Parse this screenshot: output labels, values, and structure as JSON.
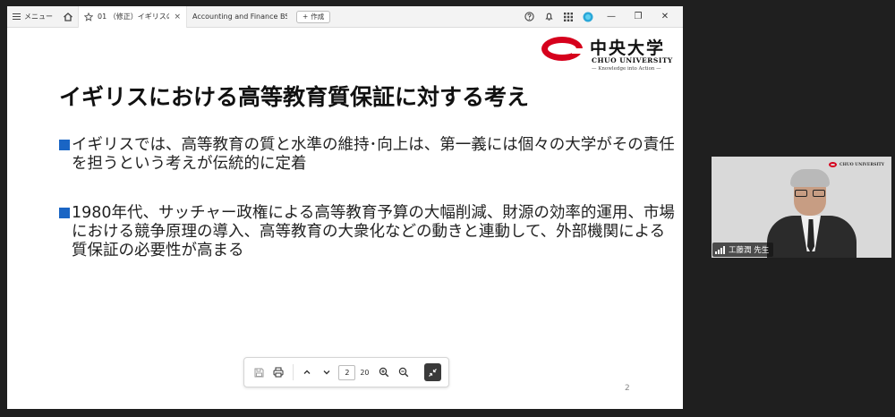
{
  "tab_bar": {
    "menu_label": "メニュー",
    "active_tab_title": "01 （修正）イギリスの...",
    "inactive_tab_title": "Accounting and Finance BSc...",
    "new_button_label": "作成",
    "close_glyph": "×",
    "new_glyph": "+"
  },
  "window_controls": {
    "minimize": "—",
    "restore": "❐",
    "close": "✕"
  },
  "slide": {
    "logo": {
      "name_jp": "中央大学",
      "name_en": "CHUO UNIVERSITY",
      "tagline": "— Knowledge into Action —"
    },
    "title": "イギリスにおける高等教育質保証に対する考え",
    "bullets": [
      "イギリスでは、高等教育の質と水準の維持･向上は、第一義には個々の大学がその責任を担うという考えが伝統的に定着",
      "1980年代、サッチャー政権による高等教育予算の大幅削減、財源の効率的運用、市場における競争原理の導入、高等教育の大衆化などの動きと連動して、外部機関による質保証の必要性が高まる"
    ],
    "page_number": "2"
  },
  "pdf_toolbar": {
    "current_page": "2",
    "total_pages": "20",
    "icons": [
      "save-icon",
      "print-icon",
      "chevron-up-icon",
      "chevron-down-icon",
      "zoom-in-icon",
      "zoom-out-icon",
      "fit-page-icon"
    ]
  },
  "video_tile": {
    "participant_name": "工藤潤 先生",
    "logo_text": "CHUO UNIVERSITY"
  },
  "colors": {
    "bullet_blue": "#1a65c4",
    "brand_red": "#d6001c",
    "background_dark": "#1f1f1f"
  }
}
